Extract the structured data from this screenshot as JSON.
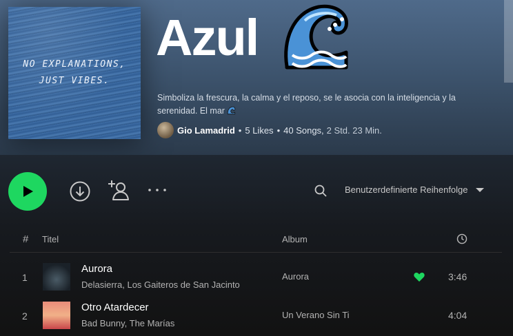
{
  "playlist": {
    "cover_text_line1": "NO EXPLANATIONS,",
    "cover_text_line2": "JUST VIBES.",
    "title": "Azul",
    "description": "Simboliza la frescura, la calma y el reposo, se le asocia con la inteligencia y la serenidad. El mar",
    "owner": "Gio Lamadrid",
    "likes": "5 Likes",
    "songs": "40 Songs,",
    "duration": "2 Std. 23 Min.",
    "title_emoji_icon": "water-wave-icon"
  },
  "actions": {
    "sort_label": "Benutzerdefinierte Reihenfolge",
    "play_icon": "play-icon",
    "download_icon": "download-icon",
    "add_user_icon": "add-user-icon",
    "more_icon": "more-icon",
    "search_icon": "search-icon"
  },
  "table": {
    "headers": {
      "number": "#",
      "title": "Titel",
      "album": "Album",
      "duration_icon": "clock-icon"
    },
    "rows": [
      {
        "number": "1",
        "title": "Aurora",
        "artist": "Delasierra, Los Gaiteros de San Jacinto",
        "album": "Aurora",
        "duration": "3:46",
        "liked": true
      },
      {
        "number": "2",
        "title": "Otro Atardecer",
        "artist": "Bad Bunny, The Marías",
        "album": "Un Verano Sin Ti",
        "duration": "4:04",
        "liked": false
      }
    ]
  },
  "colors": {
    "accent_green": "#1ed760",
    "header_blue": "#4f6a8a"
  }
}
